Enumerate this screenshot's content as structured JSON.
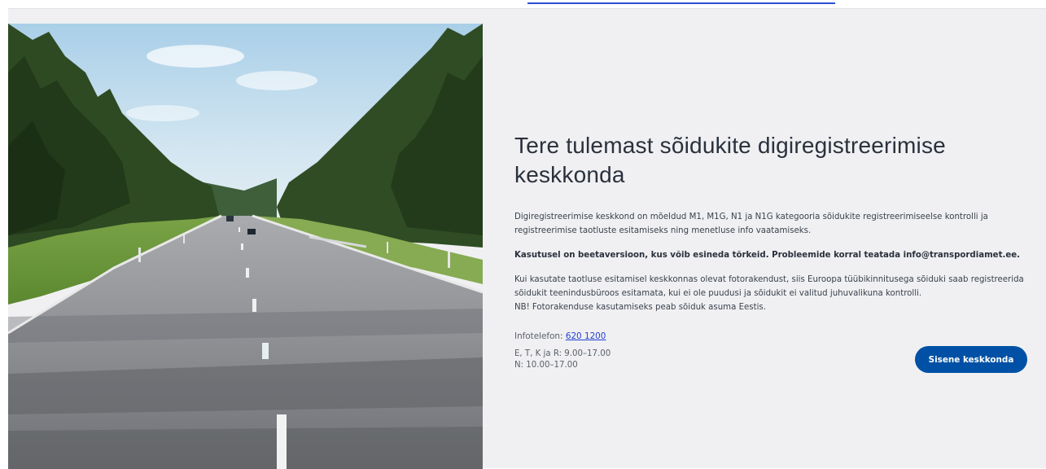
{
  "page_title": "Tere tulemast sõidukite digiregistreerimise keskkonda",
  "intro_text": "Digiregistreerimise keskkond on mõeldud M1, M1G, N1 ja N1G kategooria sõidukite registreerimiseelse kontrolli ja registreerimise taotluste esitamiseks ning menetluse info vaatamiseks.",
  "beta_notice": "Kasutusel on beetaversioon, kus võib esineda tõrkeid. Probleemide korral teatada info@transpordiamet.ee.",
  "photo_service": {
    "line1": "Kui kasutate taotluse esitamisel keskkonnas olevat fotorakendust, siis Euroopa tüübikinnitusega sõiduki saab registreerida sõidukit teenindusbüroos esitamata, kui ei ole puudusi ja sõidukit ei valitud juhuvalikuna kontrolli.",
    "line2": "NB! Fotorakenduse kasutamiseks peab sõiduk asuma Eestis."
  },
  "contact": {
    "phone_label": "Infotelefon:",
    "phone_number": "620 1200",
    "hours_weekdays": "E, T, K ja R: 9.00–17.00",
    "hours_thursday": "N: 10.00–17.00"
  },
  "enter_button": "Sisene keskkonda",
  "colors": {
    "background": "#f0f0f2",
    "primary": "#0051a5",
    "link": "#1f3fd6",
    "heading": "#2a313c"
  },
  "hero_image": "road-through-forest-photo"
}
